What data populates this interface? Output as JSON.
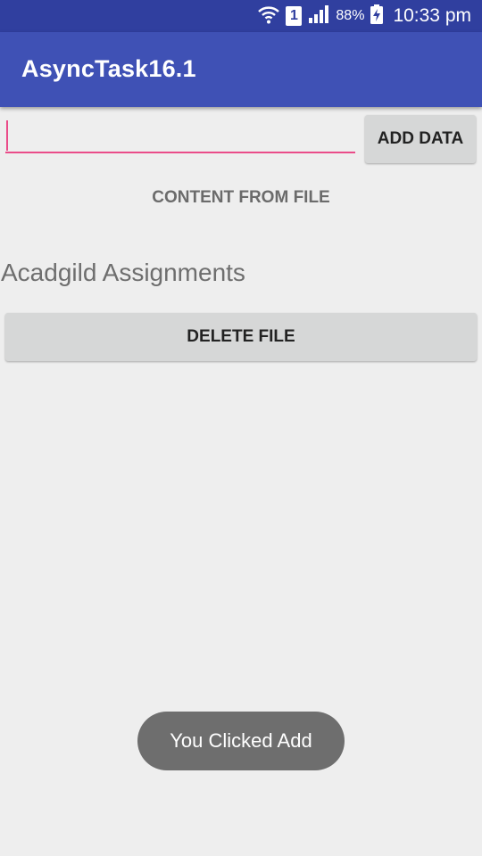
{
  "status_bar": {
    "sim_slot": "1",
    "battery_percent": "88%",
    "time": "10:33 pm",
    "icons": [
      "wifi-icon",
      "sim-icon",
      "signal-icon",
      "battery-charging-icon"
    ]
  },
  "app_bar": {
    "title": "AsyncTask16.1",
    "color": "#3f51b5",
    "status_color": "#303f9f"
  },
  "input": {
    "value": "",
    "accent_color": "#ea4c89"
  },
  "buttons": {
    "add_label": "ADD DATA",
    "delete_label": "DELETE FILE"
  },
  "content": {
    "label": "CONTENT FROM FILE",
    "text": "Acadgild Assignments"
  },
  "toast": {
    "message": "You Clicked Add"
  }
}
